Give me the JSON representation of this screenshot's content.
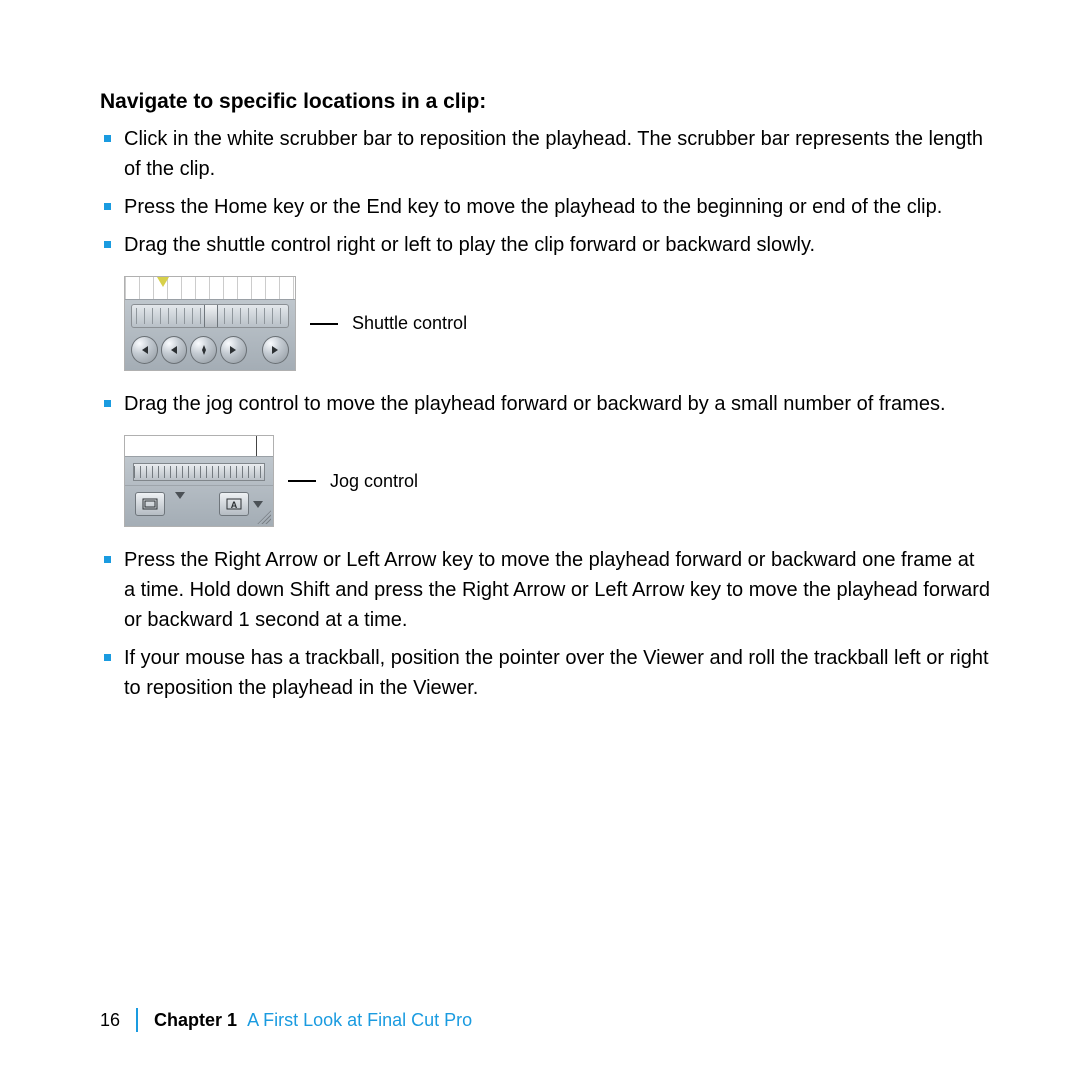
{
  "heading": "Navigate to specific locations in a clip:",
  "bullets_top": [
    "Click in the white scrubber bar to reposition the playhead. The scrubber bar represents the length of the clip.",
    "Press the Home key or the End key to move the playhead to the beginning or end of the clip.",
    "Drag the shuttle control right or left to play the clip forward or backward slowly."
  ],
  "shuttle_label": "Shuttle control",
  "bullets_mid": [
    "Drag the jog control to move the playhead forward or backward by a small number of frames."
  ],
  "jog_label": "Jog control",
  "bullets_bottom": [
    "Press the Right Arrow or Left Arrow key to move the playhead forward or backward one frame at a time. Hold down Shift and press the Right Arrow or Left Arrow key to move the playhead forward or backward 1 second at a time.",
    "If your mouse has a trackball, position the pointer over the Viewer and roll the trackball left or right to reposition the playhead in the Viewer."
  ],
  "footer": {
    "page": "16",
    "chapter_label": "Chapter 1",
    "chapter_title": "A First Look at Final Cut Pro"
  }
}
